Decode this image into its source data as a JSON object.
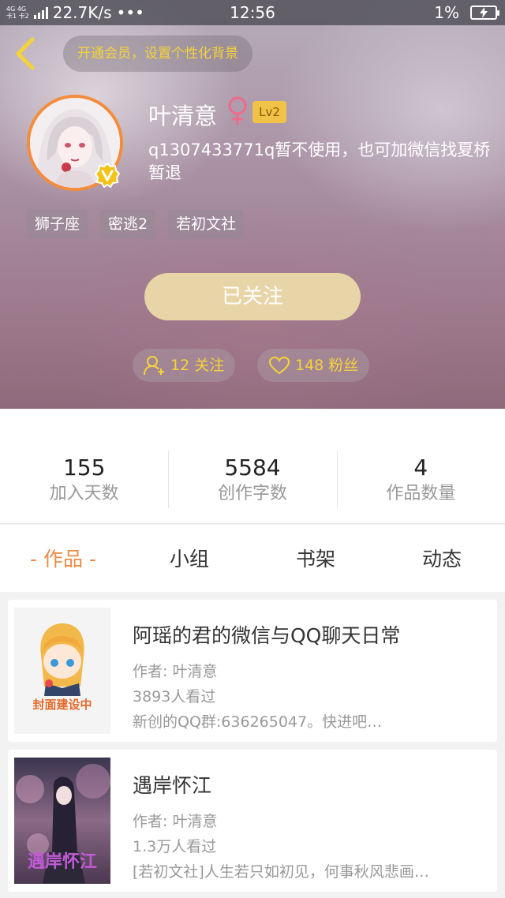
{
  "status_bar": {
    "network_label": "4G 4G",
    "carrier_label": "卡1 卡2",
    "speed": "22.7K/s",
    "more": "•••",
    "time": "12:56",
    "battery": "1%"
  },
  "header": {
    "vip_prompt": "开通会员，设置个性化背景",
    "username": "叶清意",
    "gender_symbol": "♀",
    "level": "Lv2",
    "signature": "q1307433771q暂不使用，也可加微信找夏桥暂退",
    "tags": [
      "狮子座",
      "密逃2",
      "若初文社"
    ],
    "follow_button": "已关注",
    "following": "12 关注",
    "fans": "148 粉丝"
  },
  "stats": [
    {
      "value": "155",
      "label": "加入天数"
    },
    {
      "value": "5584",
      "label": "创作字数"
    },
    {
      "value": "4",
      "label": "作品数量"
    }
  ],
  "tabs": [
    "- 作品 -",
    "小组",
    "书架",
    "动态"
  ],
  "works": [
    {
      "title": "阿瑶的君的微信与QQ聊天日常",
      "author": "作者: 叶清意",
      "views": "3893人看过",
      "desc": "新创的QQ群:636265047。快进吧…",
      "cover_text": "封面建设中"
    },
    {
      "title": "遇岸怀江",
      "author": "作者: 叶清意",
      "views": "1.3万人看过",
      "desc": "[若初文社]人生若只如初见，何事秋风悲画…",
      "cover_text": "遇岸怀江"
    }
  ],
  "colors": {
    "accent": "#ee8a46",
    "vip_yellow": "#f5d23a",
    "follow_button": "#e7d5a8"
  }
}
